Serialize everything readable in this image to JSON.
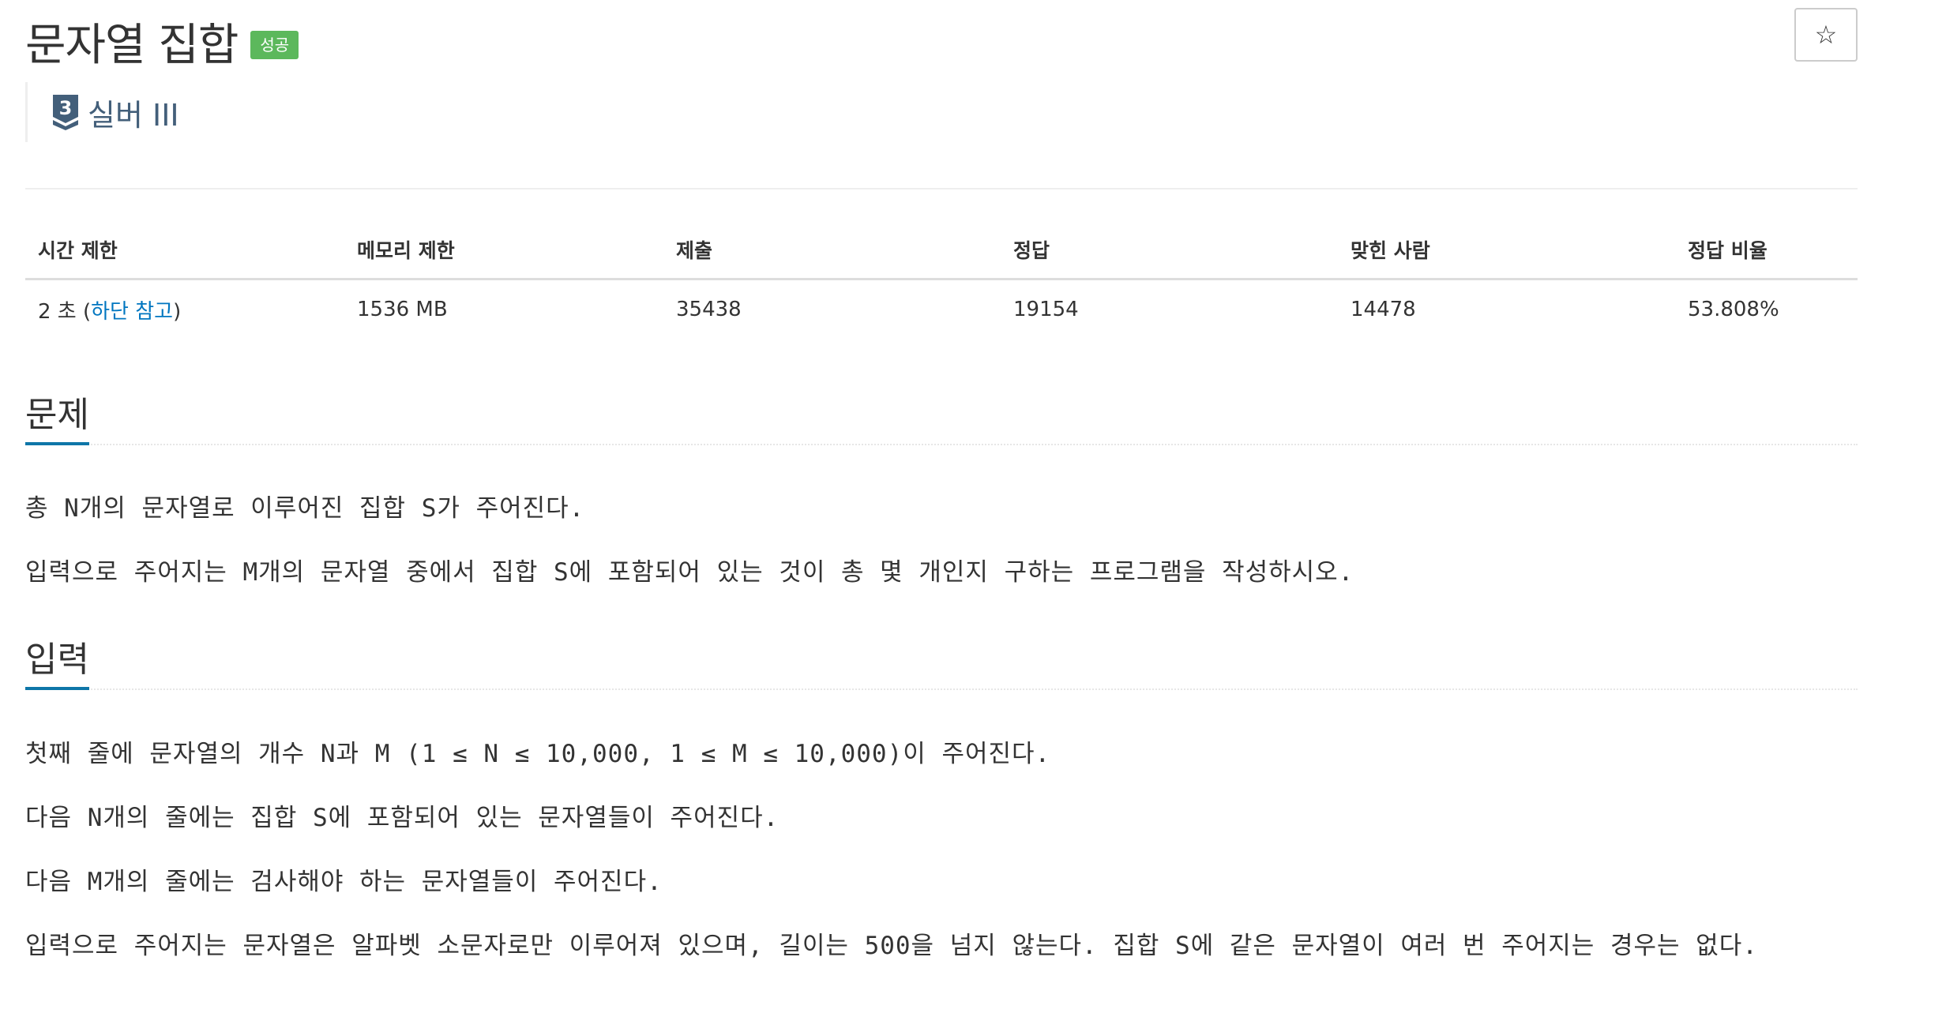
{
  "header": {
    "title": "문자열 집합",
    "status_badge": "성공",
    "star_icon": "☆"
  },
  "tier": {
    "number": "3",
    "label": "실버 III",
    "color": "#435f7a"
  },
  "info_table": {
    "headers": [
      "시간 제한",
      "메모리 제한",
      "제출",
      "정답",
      "맞힌 사람",
      "정답 비율"
    ],
    "time_limit_prefix": "2 초 (",
    "time_limit_link": "하단 참고",
    "time_limit_suffix": ")",
    "memory_limit": "1536 MB",
    "submissions": "35438",
    "accepted": "19154",
    "solvers": "14478",
    "ratio": "53.808%"
  },
  "problem": {
    "heading": "문제",
    "paragraphs": [
      "총 N개의 문자열로 이루어진 집합 S가 주어진다.",
      "입력으로 주어지는 M개의 문자열 중에서 집합 S에 포함되어 있는 것이 총 몇 개인지 구하는 프로그램을 작성하시오."
    ]
  },
  "input": {
    "heading": "입력",
    "paragraphs": [
      "첫째 줄에 문자열의 개수 N과 M (1 ≤ N ≤ 10,000, 1 ≤ M ≤ 10,000)이 주어진다.",
      "다음 N개의 줄에는 집합 S에 포함되어 있는 문자열들이 주어진다.",
      "다음 M개의 줄에는 검사해야 하는 문자열들이 주어진다.",
      "입력으로 주어지는 문자열은 알파벳 소문자로만 이루어져 있으며, 길이는 500을 넘지 않는다. 집합 S에 같은 문자열이 여러 번 주어지는 경우는 없다."
    ]
  },
  "colors": {
    "success_badge": "#5cb85c",
    "link": "#0076c0",
    "section_underline": "#0e76a8"
  }
}
